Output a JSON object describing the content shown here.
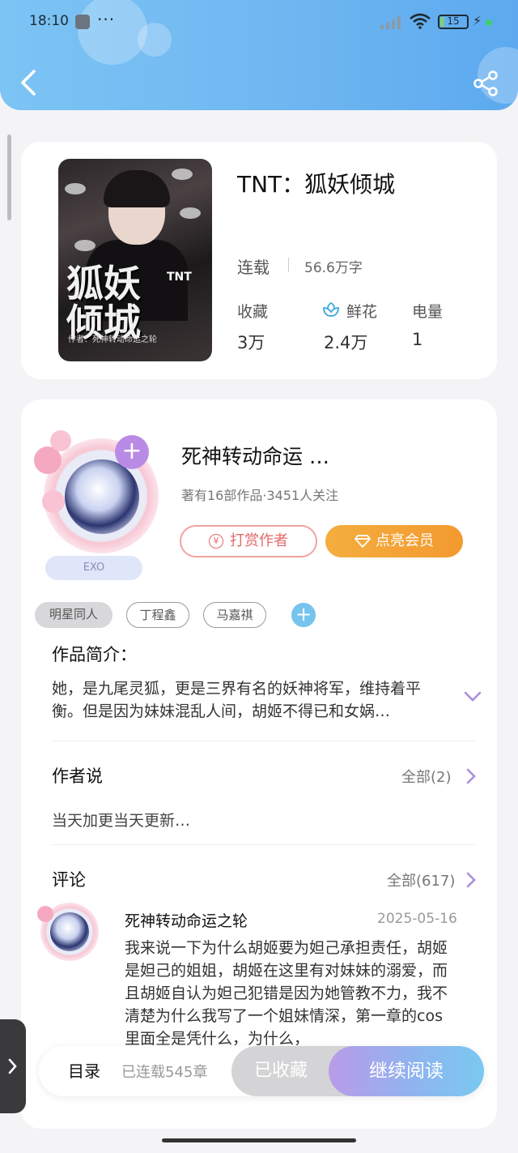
{
  "status_bar": {
    "time": "18:10",
    "dots": "···",
    "battery": "15",
    "bolt": "⚡"
  },
  "book": {
    "title": "TNT：狐妖倾城",
    "status": "连载",
    "word_count": "56.6万字",
    "stats": [
      {
        "label": "收藏",
        "value": "3万"
      },
      {
        "label": "鲜花",
        "value": "2.4万"
      },
      {
        "label": "电量",
        "value": "1"
      }
    ],
    "cover": {
      "title_line1": "狐妖",
      "title_line2": "倾城",
      "badge": "TNT",
      "credit": "作者：死神转动命运之轮"
    }
  },
  "author": {
    "name": "死神转动命运 …",
    "meta": "著有16部作品·3451人关注",
    "badge": "EXO",
    "follow_icon": "+",
    "reward_button": "打赏作者",
    "reward_icon": "¥",
    "vip_button": "点亮会员",
    "tags": [
      "明星同人",
      "丁程鑫",
      "马嘉祺"
    ],
    "tag_add_icon": "+"
  },
  "synopsis": {
    "heading": "作品简介：",
    "text": "她，是九尾灵狐，更是三界有名的妖神将军，维持着平衡。但是因为妹妹混乱人间，胡姬不得已和女娲…"
  },
  "author_note": {
    "heading": "作者说",
    "all_label": "全部(2)",
    "text": "当天加更当天更新…"
  },
  "comments": {
    "heading": "评论",
    "all_label": "全部(617)",
    "items": [
      {
        "user": "死神转动命运之轮",
        "date": "2025-05-16",
        "text": "我来说一下为什么胡姬要为妲己承担责任，胡姬是妲己的姐姐，胡姬在这里有对妹妹的溺爱，而且胡姬自认为妲己犯错是因为她管教不力，我不清楚为什么我写了一个姐妹情深，第一章的cos里面全是凭什么，为什么，"
      }
    ]
  },
  "bottom_bar": {
    "toc": "目录",
    "toc_meta": "已连载545章",
    "collected": "已收藏",
    "read": "继续阅读"
  },
  "colors": {
    "header_blue": "#6fb7f1",
    "vip_orange": "#f39a2f",
    "reward_red": "#e36a6a",
    "tag_blue": "#76c4ee",
    "follow_purple": "#b98be6"
  },
  "icons": [
    "back-arrow-icon",
    "share-icon",
    "flower-icon",
    "chevron-down-icon",
    "chevron-right-icon",
    "diamond-icon",
    "coin-icon",
    "signal-icon",
    "wifi-icon",
    "battery-icon"
  ]
}
